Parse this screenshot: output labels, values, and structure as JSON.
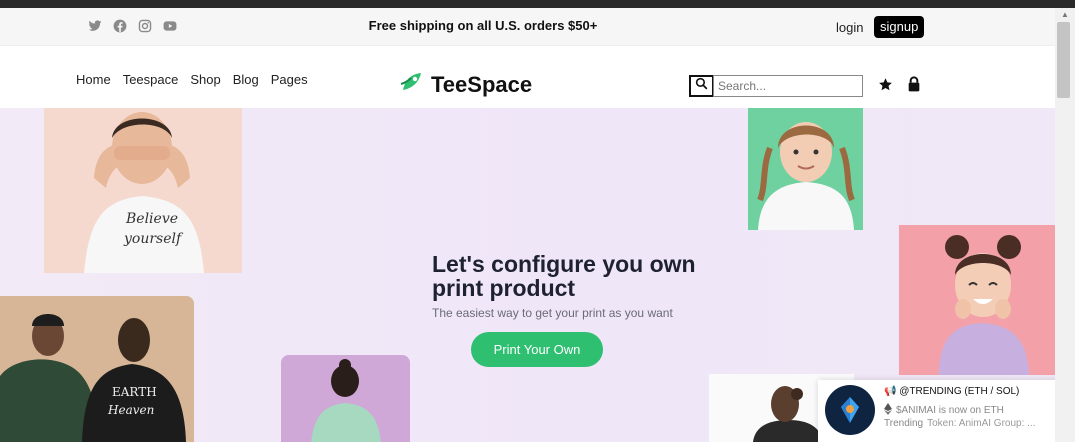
{
  "topbar": {
    "social_icons": [
      "twitter-icon",
      "facebook-icon",
      "instagram-icon",
      "youtube-icon"
    ],
    "shipping_text": "Free shipping on all U.S. orders $50+",
    "login_label": "login",
    "signup_label": "signup"
  },
  "nav": {
    "links": [
      "Home",
      "Teespace",
      "Shop",
      "Blog",
      "Pages"
    ],
    "logo_text": "TeeSpace",
    "search_placeholder": "Search...",
    "icons": [
      "search-icon",
      "star-icon",
      "lock-icon"
    ]
  },
  "hero": {
    "headline_line1": "Let's configure you own",
    "headline_line2": "print product",
    "subline": "The easiest way to get your print as you want",
    "cta_label": "Print Your Own"
  },
  "notification": {
    "title": "@TRENDING (ETH / SOL)",
    "line2": "$ANIMAI is now on ETH",
    "line3_label": "Trending",
    "line3_text": "Token: AnimAI Group: ...",
    "close_label": "×"
  },
  "colors": {
    "accent_green": "#2fbf71",
    "hero_bg": "#efe6f8",
    "signup_bg": "#000000"
  }
}
